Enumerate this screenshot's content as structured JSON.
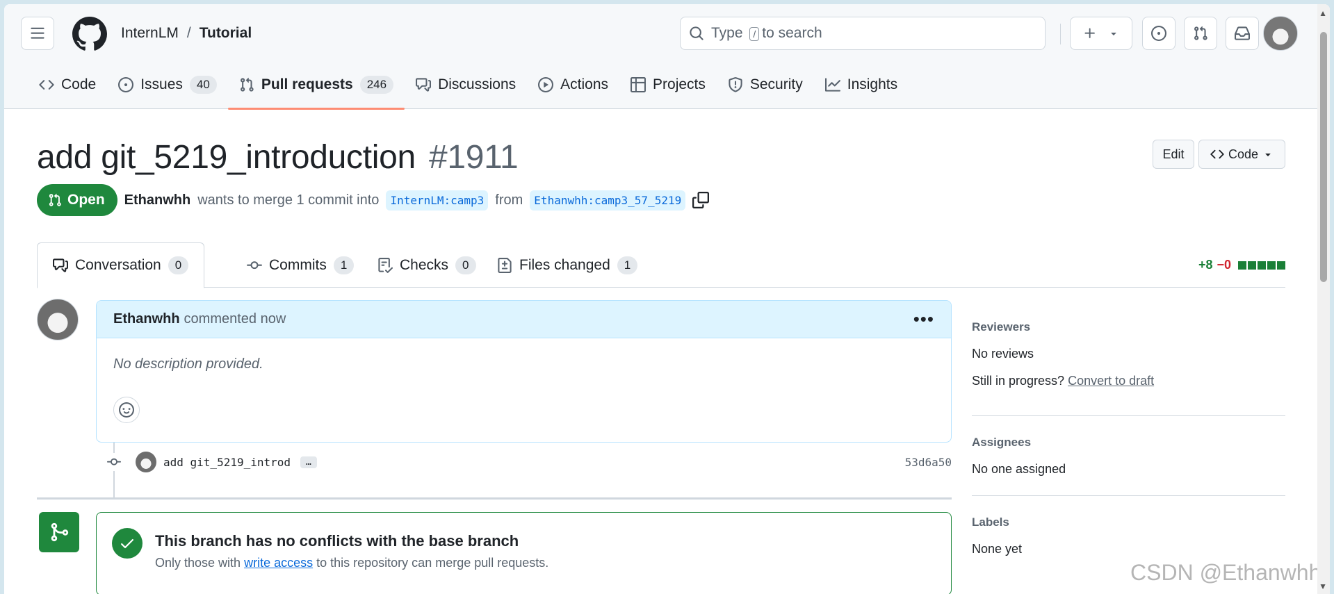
{
  "header": {
    "owner": "InternLM",
    "separator": "/",
    "repo": "Tutorial",
    "search_prefix": "Type",
    "search_key": "/",
    "search_suffix": "to search"
  },
  "repo_tabs": [
    {
      "label": "Code",
      "count": ""
    },
    {
      "label": "Issues",
      "count": "40"
    },
    {
      "label": "Pull requests",
      "count": "246"
    },
    {
      "label": "Discussions",
      "count": ""
    },
    {
      "label": "Actions",
      "count": ""
    },
    {
      "label": "Projects",
      "count": ""
    },
    {
      "label": "Security",
      "count": ""
    },
    {
      "label": "Insights",
      "count": ""
    }
  ],
  "pr": {
    "title": "add git_5219_introduction",
    "number": "#1911",
    "edit_label": "Edit",
    "code_label": "Code",
    "state": "Open",
    "author": "Ethanwhh",
    "merge_text": "wants to merge 1 commit into",
    "base_branch": "InternLM:camp3",
    "from_text": "from",
    "head_branch": "Ethanwhh:camp3_57_5219"
  },
  "pr_tabs": [
    {
      "label": "Conversation",
      "count": "0"
    },
    {
      "label": "Commits",
      "count": "1"
    },
    {
      "label": "Checks",
      "count": "0"
    },
    {
      "label": "Files changed",
      "count": "1"
    }
  ],
  "diffstat": {
    "additions": "+8",
    "deletions": "−0"
  },
  "comment": {
    "author": "Ethanwhh",
    "action": "commented now",
    "body": "No description provided."
  },
  "commit": {
    "message": "add git_5219_introd",
    "more": "…",
    "sha": "53d6a50"
  },
  "merge": {
    "title": "This branch has no conflicts with the base branch",
    "sub_prefix": "Only those with",
    "sub_link": "write access",
    "sub_suffix": "to this repository can merge pull requests."
  },
  "sidebar": {
    "reviewers_heading": "Reviewers",
    "reviewers_value": "No reviews",
    "in_progress_text": "Still in progress?",
    "convert_link": "Convert to draft",
    "assignees_heading": "Assignees",
    "assignees_value": "No one assigned",
    "labels_heading": "Labels",
    "labels_value": "None yet"
  },
  "watermark": "CSDN @Ethanwhh",
  "colors": {
    "accent": "#1f883d",
    "link": "#0969da",
    "tab_underline": "#fd8c73"
  }
}
